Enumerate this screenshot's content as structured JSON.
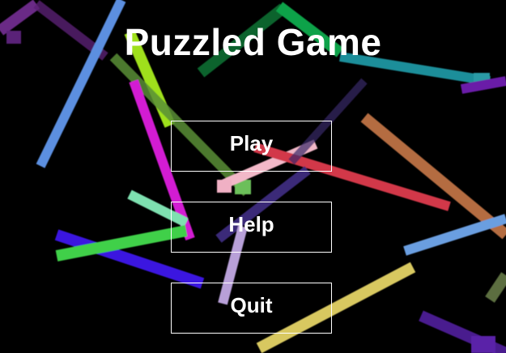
{
  "title": "Puzzled Game",
  "menu": {
    "play_label": "Play",
    "help_label": "Help",
    "quit_label": "Quit"
  },
  "colors": {
    "background": "#000000",
    "text": "#ffffff",
    "button_border": "#ffffff"
  }
}
